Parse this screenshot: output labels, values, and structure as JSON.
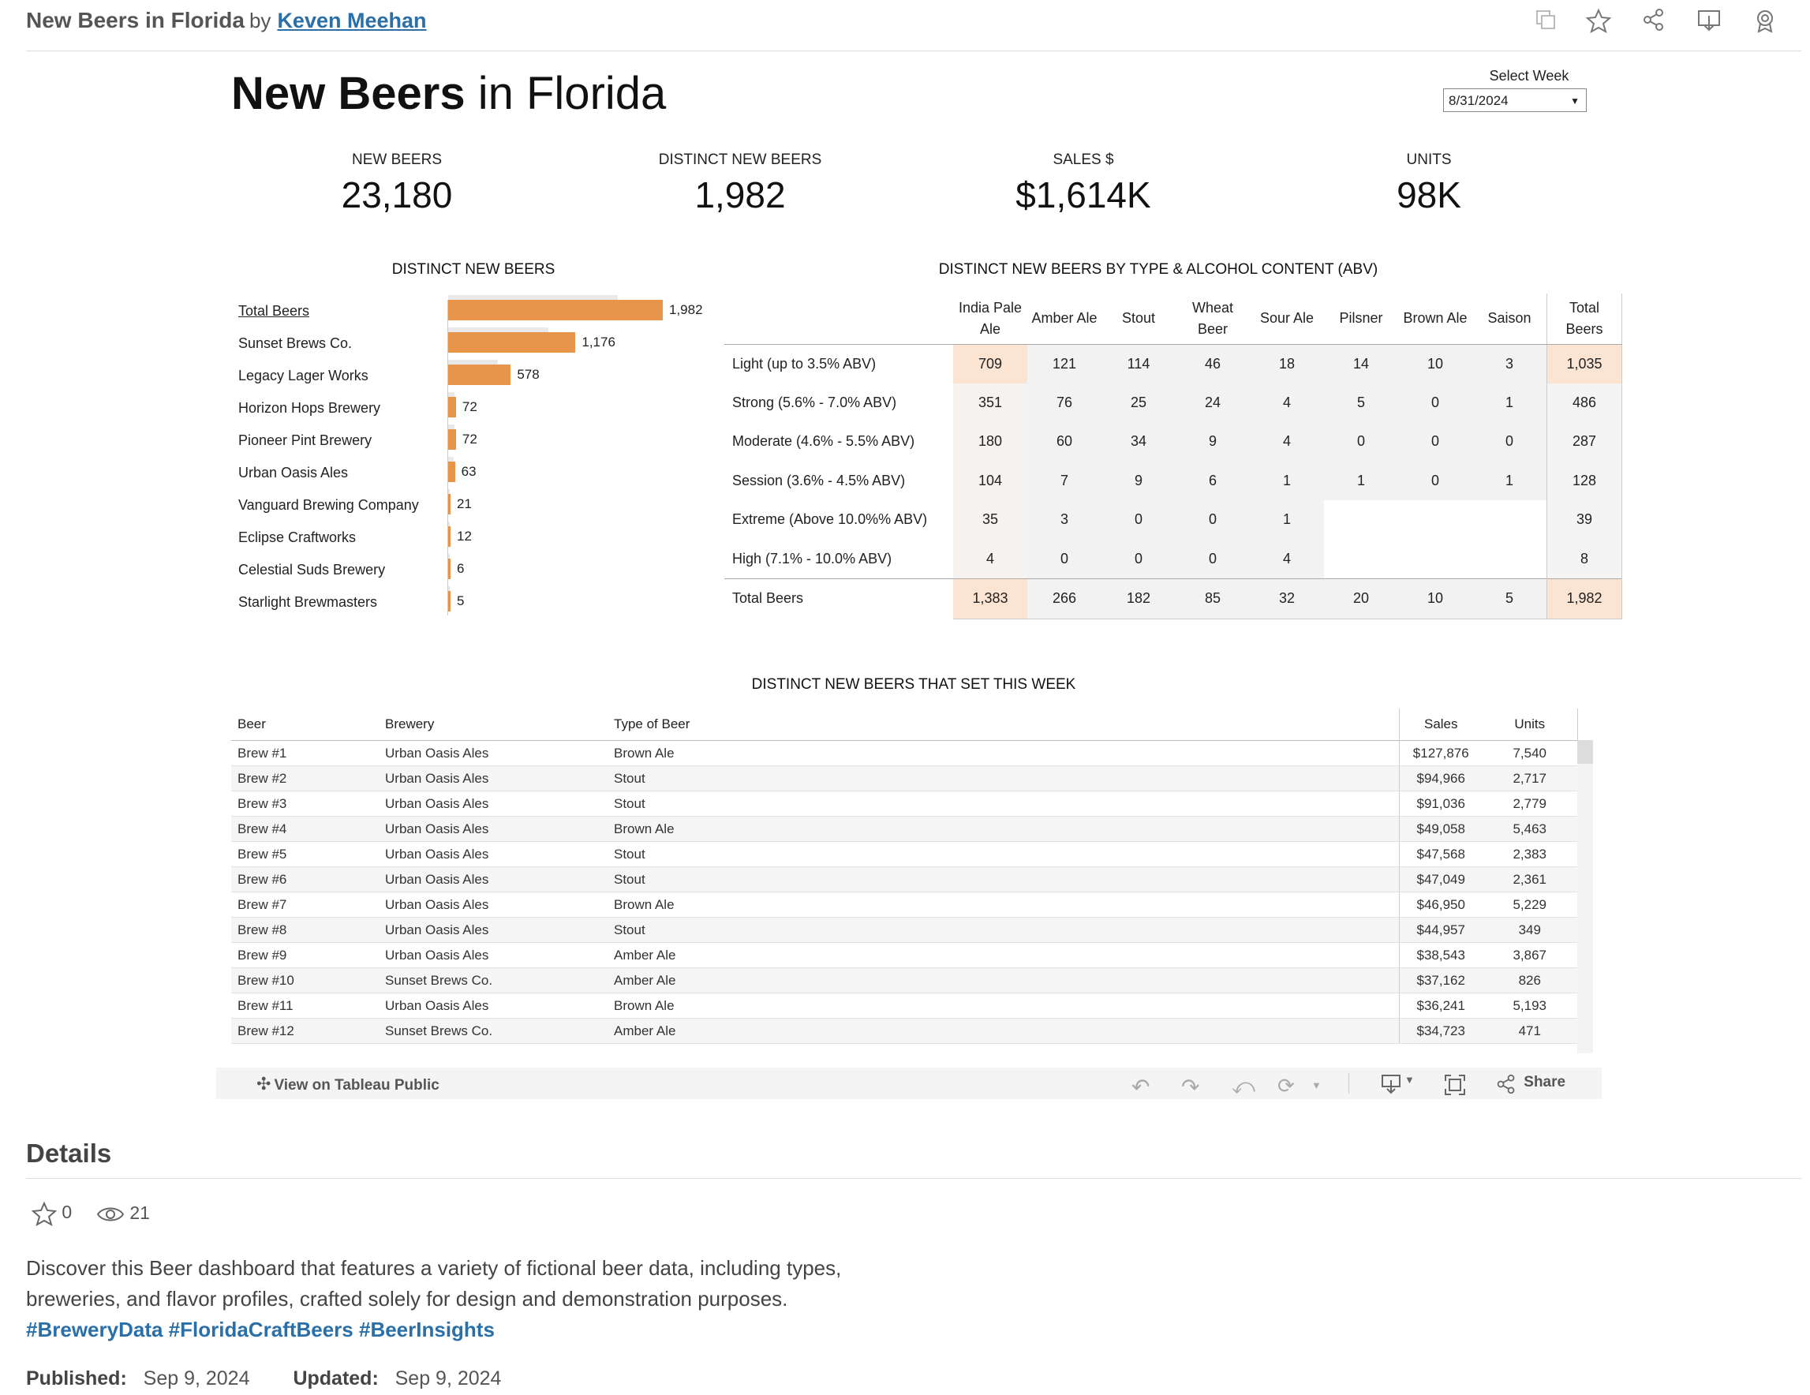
{
  "header": {
    "title": "New Beers in Florida",
    "by": "by",
    "author": "Keven Meehan",
    "icons": [
      "copy-icon",
      "star-icon",
      "share-icon",
      "download-icon",
      "badge-icon"
    ]
  },
  "dashboard": {
    "title_bold": "New Beers",
    "title_rest": "in Florida",
    "select_week": {
      "label": "Select Week",
      "value": "8/31/2024"
    },
    "kpis": [
      {
        "label": "NEW BEERS",
        "value": "23,180"
      },
      {
        "label": "DISTINCT NEW BEERS",
        "value": "1,982"
      },
      {
        "label": "SALES $",
        "value": "$1,614K"
      },
      {
        "label": "UNITS",
        "value": "98K"
      }
    ]
  },
  "chart_data": {
    "type": "bar",
    "title": "DISTINCT NEW BEERS",
    "orientation": "horizontal",
    "categories": [
      "Total Beers",
      "Sunset Brews Co.",
      "Legacy Lager Works",
      "Horizon Hops Brewery",
      "Pioneer Pint Brewery",
      "Urban Oasis Ales",
      "Vanguard Brewing Company",
      "Eclipse Craftworks",
      "Celestial Suds Brewery",
      "Starlight Brewmasters"
    ],
    "values": [
      1982,
      1176,
      578,
      72,
      72,
      63,
      21,
      12,
      6,
      5
    ],
    "value_labels": [
      "1,982",
      "1,176",
      "578",
      "72",
      "72",
      "63",
      "21",
      "12",
      "6",
      "5"
    ],
    "bar_color": "#e8954b"
  },
  "matrix": {
    "title": "DISTINCT NEW BEERS BY TYPE & ALCOHOL CONTENT (ABV)",
    "columns": [
      "India Pale Ale",
      "Amber Ale",
      "Stout",
      "Wheat Beer",
      "Sour Ale",
      "Pilsner",
      "Brown Ale",
      "Saison",
      "Total Beers"
    ],
    "rows": [
      {
        "label": "Light (up to 3.5% ABV)",
        "values": [
          "709",
          "121",
          "114",
          "46",
          "18",
          "14",
          "10",
          "3",
          "1,035"
        ]
      },
      {
        "label": "Strong (5.6% - 7.0% ABV)",
        "values": [
          "351",
          "76",
          "25",
          "24",
          "4",
          "5",
          "0",
          "1",
          "486"
        ]
      },
      {
        "label": "Moderate (4.6% - 5.5% ABV)",
        "values": [
          "180",
          "60",
          "34",
          "9",
          "4",
          "0",
          "0",
          "0",
          "287"
        ]
      },
      {
        "label": "Session (3.6% - 4.5% ABV)",
        "values": [
          "104",
          "7",
          "9",
          "6",
          "1",
          "1",
          "0",
          "1",
          "128"
        ]
      },
      {
        "label": "Extreme (Above 10.0%% ABV)",
        "values": [
          "35",
          "3",
          "0",
          "0",
          "1",
          "",
          "",
          "",
          "39"
        ]
      },
      {
        "label": "High (7.1% - 10.0% ABV)",
        "values": [
          "4",
          "0",
          "0",
          "0",
          "4",
          "",
          "",
          "",
          "8"
        ]
      }
    ],
    "total": {
      "label": "Total Beers",
      "values": [
        "1,383",
        "266",
        "182",
        "85",
        "32",
        "20",
        "10",
        "5",
        "1,982"
      ]
    }
  },
  "list": {
    "title": "DISTINCT NEW BEERS THAT SET THIS WEEK",
    "headers": [
      "Beer",
      "Brewery",
      "Type of Beer",
      "Sales",
      "Units"
    ],
    "rows": [
      [
        "Brew #1",
        "Urban Oasis Ales",
        "Brown Ale",
        "$127,876",
        "7,540"
      ],
      [
        "Brew #2",
        "Urban Oasis Ales",
        "Stout",
        "$94,966",
        "2,717"
      ],
      [
        "Brew #3",
        "Urban Oasis Ales",
        "Stout",
        "$91,036",
        "2,779"
      ],
      [
        "Brew #4",
        "Urban Oasis Ales",
        "Brown Ale",
        "$49,058",
        "5,463"
      ],
      [
        "Brew #5",
        "Urban Oasis Ales",
        "Stout",
        "$47,568",
        "2,383"
      ],
      [
        "Brew #6",
        "Urban Oasis Ales",
        "Stout",
        "$47,049",
        "2,361"
      ],
      [
        "Brew #7",
        "Urban Oasis Ales",
        "Brown Ale",
        "$46,950",
        "5,229"
      ],
      [
        "Brew #8",
        "Urban Oasis Ales",
        "Stout",
        "$44,957",
        "349"
      ],
      [
        "Brew #9",
        "Urban Oasis Ales",
        "Amber Ale",
        "$38,543",
        "3,867"
      ],
      [
        "Brew #10",
        "Sunset Brews Co.",
        "Amber Ale",
        "$37,162",
        "826"
      ],
      [
        "Brew #11",
        "Urban Oasis Ales",
        "Brown Ale",
        "$36,241",
        "5,193"
      ],
      [
        "Brew #12",
        "Sunset Brews Co.",
        "Amber Ale",
        "$34,723",
        "471"
      ]
    ]
  },
  "toolbar": {
    "view_label": "View on Tableau Public",
    "share_label": "Share"
  },
  "details": {
    "heading": "Details",
    "favorites": "0",
    "views": "21",
    "description": "Discover this Beer dashboard that features a variety of fictional beer data, including types, breweries, and flavor profiles, crafted solely for design and demonstration purposes.",
    "tags": [
      "#BreweryData",
      "#FloridaCraftBeers",
      "#BeerInsights"
    ],
    "published_label": "Published:",
    "published": "Sep 9, 2024",
    "updated_label": "Updated:",
    "updated": "Sep 9, 2024"
  }
}
